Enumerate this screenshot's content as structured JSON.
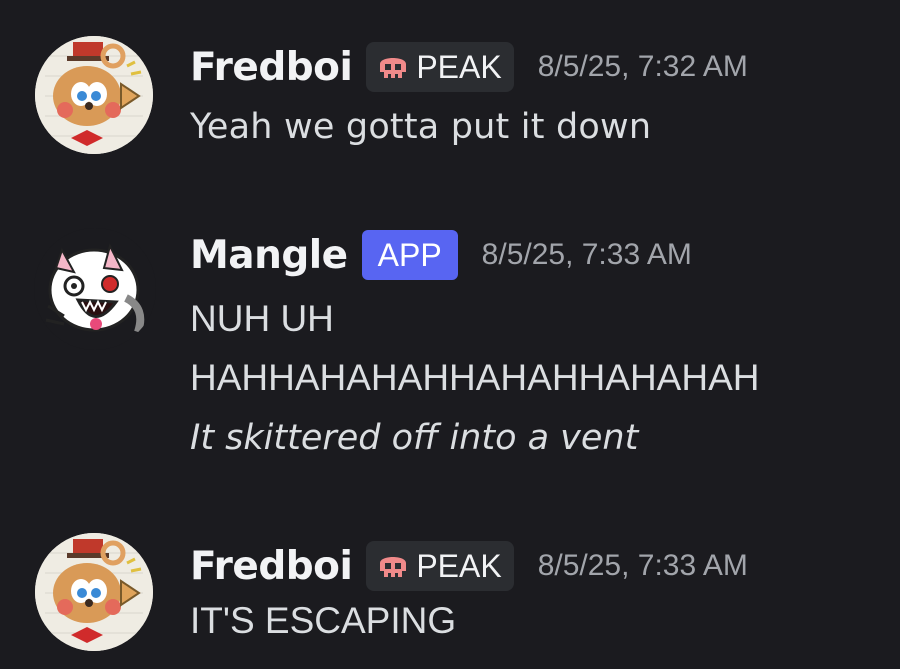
{
  "messages": [
    {
      "username": "Fredboi",
      "role_tag": {
        "label": "PEAK",
        "icon": "skull-icon"
      },
      "timestamp": "8/5/25, 7:32 AM",
      "lines": [
        "Yeah we gotta put it down"
      ]
    },
    {
      "username": "Mangle",
      "badge": "APP",
      "timestamp": "8/5/25, 7:33 AM",
      "lines": [
        "NUH UH",
        "HAHHAHAHAHHAHAHHAHAHAH",
        "It skittered off into a vent"
      ]
    },
    {
      "username": "Fredboi",
      "role_tag": {
        "label": "PEAK",
        "icon": "skull-icon"
      },
      "timestamp": "8/5/25, 7:33 AM",
      "lines": [
        "IT'S ESCAPING"
      ]
    }
  ],
  "colors": {
    "background": "#1b1b1f",
    "username": "#f2f3f5",
    "message_text": "#dbdee1",
    "timestamp": "#a2a5ab",
    "role_tag_bg": "#2b2d31",
    "app_badge_bg": "#5865f2",
    "skull": "#f08a8a"
  }
}
